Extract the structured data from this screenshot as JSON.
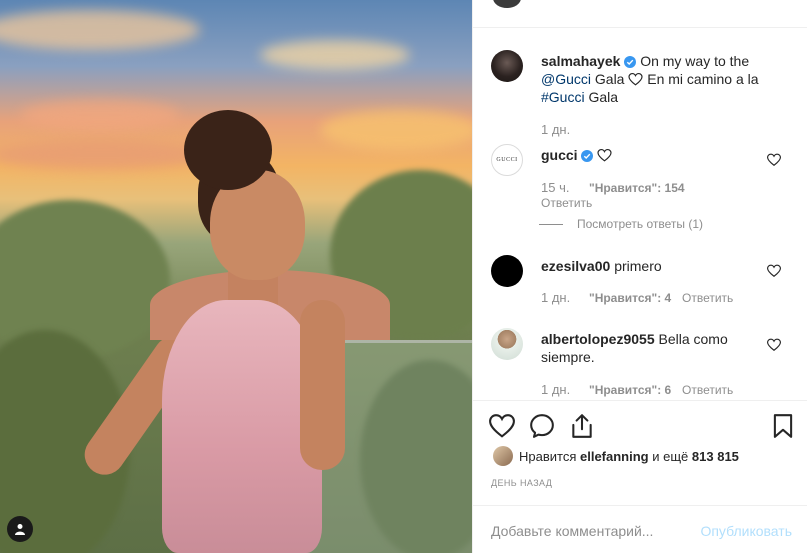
{
  "post": {
    "author": "salmahayek",
    "caption_parts": {
      "line1_text": "On my way to the",
      "mention": "@Gucci",
      "line2_text": "Gala",
      "line2_rest": "En mi camino a la",
      "hashtag": "#Gucci",
      "line3_text": "Gala"
    },
    "time": "1 дн."
  },
  "comments": [
    {
      "username": "gucci",
      "verified": true,
      "time": "15 ч.",
      "likes": "\"Нравится\": 154",
      "reply": "Ответить",
      "view_replies": "Посмотреть ответы (1)"
    },
    {
      "username": "ezesilva00",
      "text": "primero",
      "time": "1 дн.",
      "likes": "\"Нравится\": 4",
      "reply": "Ответить"
    },
    {
      "username": "albertolopez9055",
      "text": "Bella como",
      "text2": "siempre.",
      "time": "1 дн.",
      "likes": "\"Нравится\": 6",
      "reply": "Ответить"
    }
  ],
  "likes": {
    "prefix": "Нравится",
    "user": "ellefanning",
    "suffix": "и ещё",
    "count": "813 815"
  },
  "date_label": "ДЕНЬ НАЗАД",
  "comment_box": {
    "placeholder": "Добавьте комментарий...",
    "publish": "Опубликовать"
  },
  "colors": {
    "link": "#00376b",
    "verified": "#3897f0",
    "muted": "#8e8e8e",
    "publish_disabled": "#b2dffc"
  },
  "icons": {
    "like": "heart-icon",
    "comment": "comment-icon",
    "share": "share-icon",
    "save": "bookmark-icon",
    "user_tags": "user-icon"
  }
}
